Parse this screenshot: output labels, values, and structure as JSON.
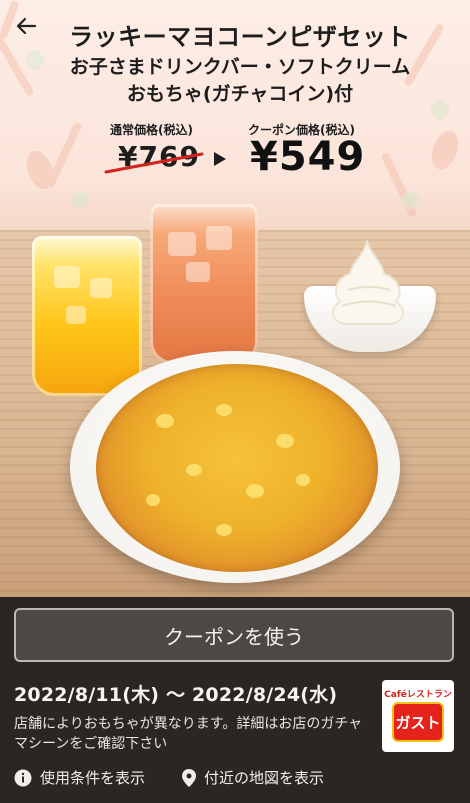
{
  "header": {
    "back_icon": "arrow-left-icon",
    "title_line1": "ラッキーマヨコーンピザセット",
    "title_line2": "お子さまドリンクバー・ソフトクリーム",
    "title_line3": "おもちゃ(ガチャコイン)付"
  },
  "price": {
    "regular_label": "通常価格(税込)",
    "regular_value": "¥769",
    "coupon_label": "クーポン価格(税込)",
    "coupon_value": "¥549"
  },
  "actions": {
    "use_coupon_label": "クーポンを使う"
  },
  "validity": {
    "period": "2022/8/11(木) 〜 2022/8/24(水)",
    "note": "店舗によりおもちゃが異なります。詳細はお店のガチャマシーンをご確認下さい"
  },
  "logo": {
    "cafe_text": "Caféレストラン",
    "brand_text": "ガスト"
  },
  "links": {
    "terms_label": "使用条件を表示",
    "terms_icon": "info-icon",
    "map_label": "付近の地図を表示",
    "map_icon": "map-pin-icon"
  },
  "colors": {
    "panel_bg": "#2b2622",
    "button_bg": "#4d4843",
    "strike_red": "#d2231e",
    "brand_red": "#e4231b"
  }
}
